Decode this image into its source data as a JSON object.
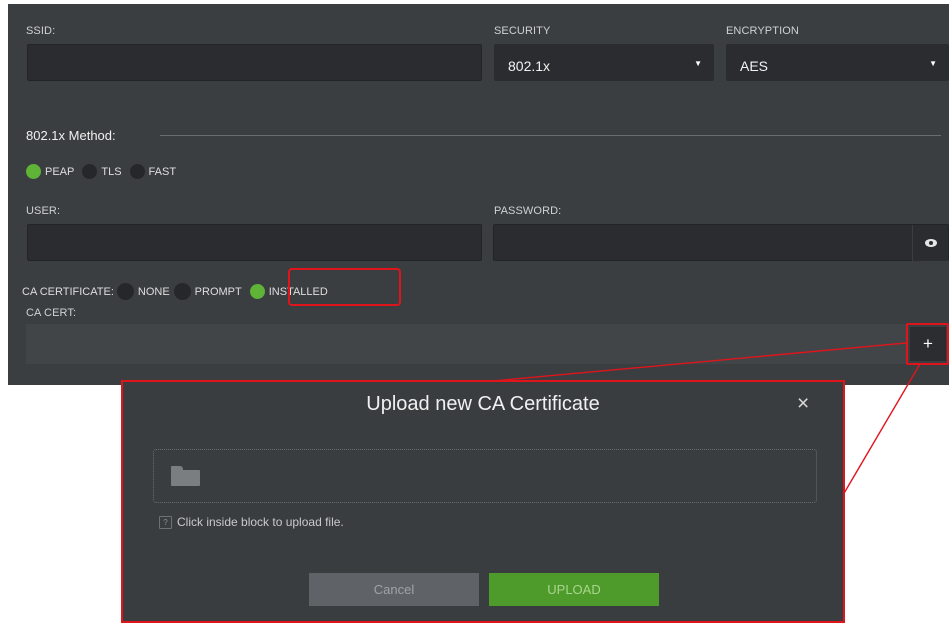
{
  "form": {
    "ssid": {
      "label": "SSID:",
      "value": ""
    },
    "security": {
      "label": "SECURITY",
      "value": "802.1x"
    },
    "encryption": {
      "label": "ENCRYPTION",
      "value": "AES"
    },
    "method": {
      "title": "802.1x Method:",
      "options": [
        "PEAP",
        "TLS",
        "FAST"
      ],
      "selected": "PEAP"
    },
    "user": {
      "label": "USER:",
      "value": ""
    },
    "password": {
      "label": "PASSWORD:",
      "value": ""
    },
    "ca_certificate": {
      "label": "CA CERTIFICATE:",
      "options": [
        "NONE",
        "PROMPT",
        "INSTALLED"
      ],
      "selected": "INSTALLED"
    },
    "ca_cert": {
      "label": "CA CERT:",
      "value": ""
    },
    "add_icon": "plus-icon",
    "add_label": "+"
  },
  "dialog": {
    "title": "Upload new CA Certificate",
    "close_label": "×",
    "hint": "Click inside block to upload file.",
    "hint_icon_label": "?",
    "cancel_label": "Cancel",
    "upload_label": "UPLOAD"
  },
  "colors": {
    "panel_bg": "#3b3e41",
    "field_bg": "#2a2c2f",
    "radio_on": "#5fb336",
    "upload_btn": "#4e9a2a",
    "cancel_btn": "#5f6368",
    "highlight": "#e0141b"
  }
}
